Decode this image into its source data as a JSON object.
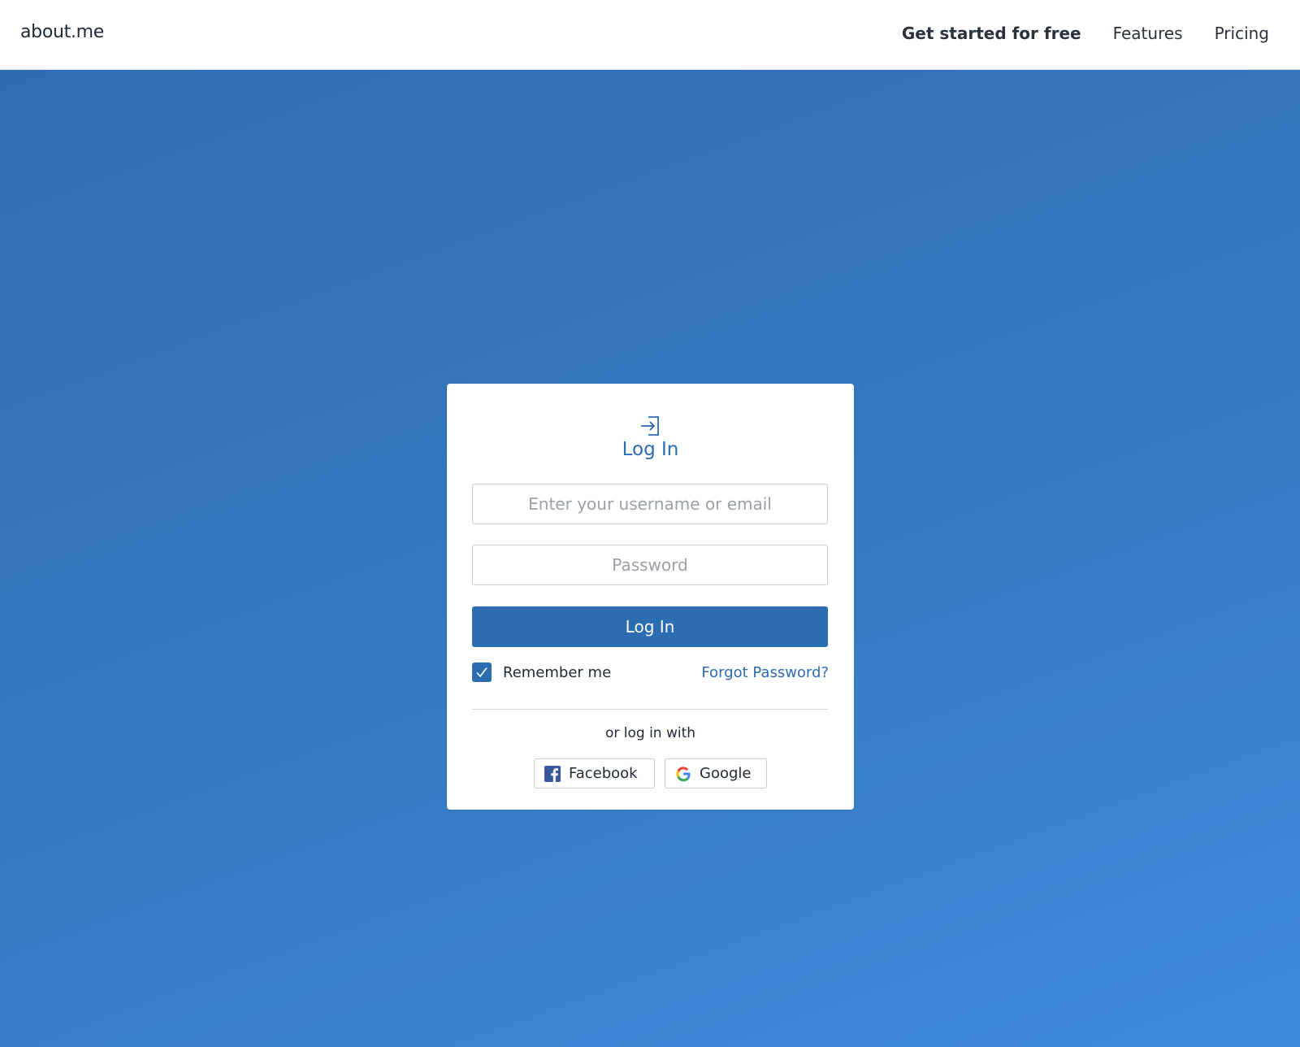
{
  "header": {
    "logo": "about.me",
    "nav": {
      "get_started": "Get started for free",
      "features": "Features",
      "pricing": "Pricing"
    }
  },
  "login": {
    "icon": "login-arrow-icon",
    "title": "Log In",
    "username_placeholder": "Enter your username or email",
    "username_value": "",
    "password_placeholder": "Password",
    "password_value": "",
    "submit_label": "Log In",
    "remember_label": "Remember me",
    "remember_checked": true,
    "forgot_label": "Forgot Password?",
    "alt_label": "or log in with",
    "social": {
      "facebook_label": "Facebook",
      "google_label": "Google"
    }
  },
  "colors": {
    "accent": "#2c6cb0",
    "background_start": "#2f6db1",
    "background_end": "#3e89db"
  }
}
